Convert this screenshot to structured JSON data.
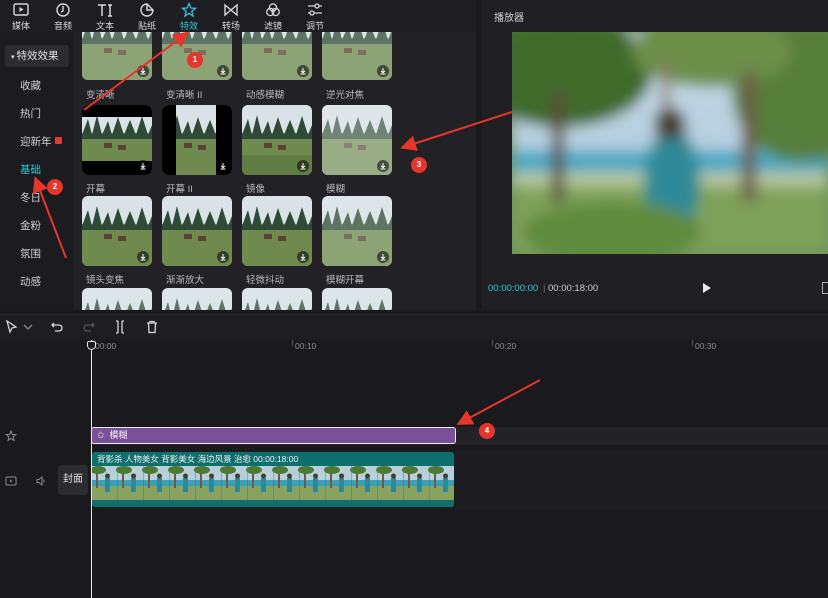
{
  "toolbar": {
    "items": [
      {
        "label": "媒体",
        "icon": "media-icon"
      },
      {
        "label": "音频",
        "icon": "audio-icon"
      },
      {
        "label": "文本",
        "icon": "text-icon"
      },
      {
        "label": "贴纸",
        "icon": "sticker-icon"
      },
      {
        "label": "特效",
        "icon": "effects-icon",
        "active": true
      },
      {
        "label": "转场",
        "icon": "transition-icon"
      },
      {
        "label": "滤镜",
        "icon": "filter-icon"
      },
      {
        "label": "调节",
        "icon": "adjust-icon"
      }
    ]
  },
  "categories": {
    "header": "特效效果",
    "items": [
      "收藏",
      "热门",
      "迎新年",
      "基础",
      "冬日",
      "金粉",
      "氛围",
      "动感"
    ],
    "selected": "基础",
    "badge_item": "迎新年"
  },
  "effects": {
    "rows": [
      [
        "变清晰",
        "变清晰 II",
        "动感模糊",
        "逆光对焦"
      ],
      [
        "开幕",
        "开幕 II",
        "镜像",
        "模糊"
      ],
      [
        "镜头变焦",
        "渐渐放大",
        "轻微抖动",
        "模糊开幕"
      ]
    ]
  },
  "player": {
    "title": "播放器",
    "current_time": "00:00:00:00",
    "total_time": "00:00:18:00"
  },
  "timeline": {
    "ruler": [
      "00:00",
      "00:10",
      "00:20",
      "00:30"
    ],
    "effect_clip": "模糊",
    "video_clip_meta": "背影杀 人物美女 背影美女 海边风景 治愈    00:00:18:00",
    "cover_label": "封面"
  },
  "annotations": [
    "1",
    "2",
    "3",
    "4"
  ],
  "colors": {
    "accent": "#2fc6d6",
    "effect_clip": "#7c4f9a",
    "video_clip": "#0f6e6e",
    "annotation": "#e6362b"
  }
}
